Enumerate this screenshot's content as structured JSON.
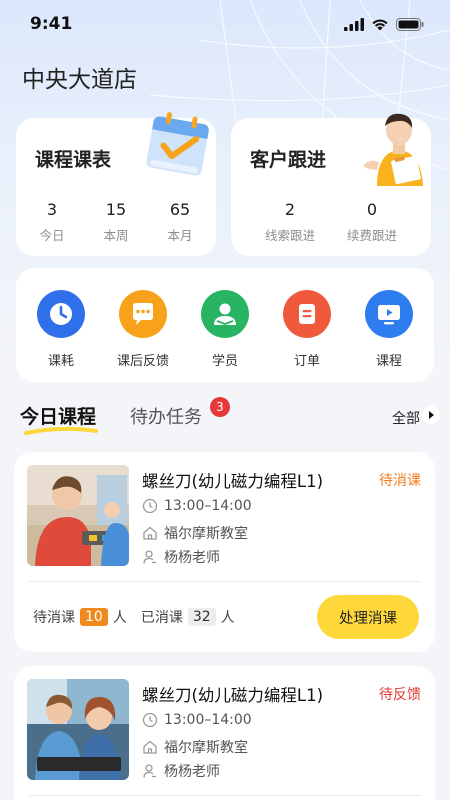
{
  "status_bar": {
    "time": "9:41"
  },
  "store_name": "中央大道店",
  "schedule_card": {
    "title": "课程课表",
    "stats": [
      {
        "value": "3",
        "label": "今日"
      },
      {
        "value": "15",
        "label": "本周"
      },
      {
        "value": "65",
        "label": "本月"
      }
    ]
  },
  "followup_card": {
    "title": "客户跟进",
    "stats": [
      {
        "value": "2",
        "label": "线索跟进"
      },
      {
        "value": "0",
        "label": "续费跟进"
      }
    ]
  },
  "quick_actions": [
    {
      "label": "课耗",
      "icon": "clock-icon",
      "color": "#2f6fea"
    },
    {
      "label": "课后反馈",
      "icon": "chat-bubble-icon",
      "color": "#f7a21a"
    },
    {
      "label": "学员",
      "icon": "student-icon",
      "color": "#28b463"
    },
    {
      "label": "订单",
      "icon": "order-icon",
      "color": "#ee5a3b"
    },
    {
      "label": "课程",
      "icon": "course-screen-icon",
      "color": "#2d7cf0"
    }
  ],
  "tabs": {
    "today": "今日课程",
    "todo": "待办任务",
    "todo_count": "3",
    "all": "全部"
  },
  "courses": [
    {
      "name": "螺丝刀(幼儿磁力编程L1)",
      "status": "待消课",
      "status_color": "#f07a1c",
      "time": "13:00–14:00",
      "room": "福尔摩斯教室",
      "teacher": "杨杨老师",
      "pending_label": "待消课",
      "pending_count": "10",
      "done_label": "已消课",
      "done_count": "32",
      "unit": "人",
      "button": "处理消课"
    },
    {
      "name": "螺丝刀(幼儿磁力编程L1)",
      "status": "待反馈",
      "status_color": "#e53935",
      "time": "13:00–14:00",
      "room": "福尔摩斯教室",
      "teacher": "杨杨老师"
    }
  ],
  "colors": {
    "accent_yellow": "#fed73a",
    "badge_red": "#e5393a",
    "pending_orange": "#f08a1c"
  }
}
